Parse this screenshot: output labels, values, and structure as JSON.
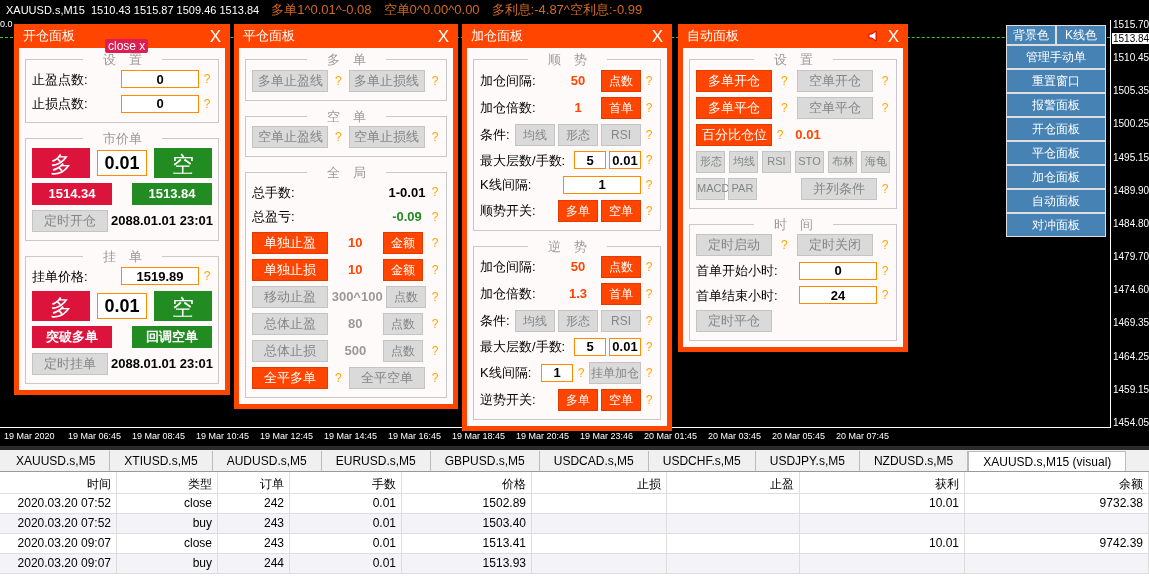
{
  "top_bar": {
    "symbol_info": "XAUUSD.s,M15  1510.43 1515.87 1509.46 1513.84",
    "stats": [
      "多单1^0.01^-0.08",
      "空单0^0.00^0.00",
      "多利息:-4.87^空利息:-0.99"
    ],
    "indicator_value": "0.0"
  },
  "panels": [
    {
      "title": "开仓面板",
      "close": "X",
      "badge": "close x",
      "sections": [
        {
          "title": "设　置",
          "rows": [
            {
              "items": [
                {
                  "kind": "label",
                  "text": "止盈点数:"
                },
                {
                  "kind": "field",
                  "text": "0"
                },
                {
                  "kind": "help",
                  "text": "?"
                }
              ]
            },
            {
              "items": [
                {
                  "kind": "label",
                  "text": "止损点数:"
                },
                {
                  "kind": "field",
                  "text": "0"
                },
                {
                  "kind": "help",
                  "text": "?"
                }
              ]
            }
          ]
        },
        {
          "title": "市价单",
          "rows": [
            {
              "items": [
                {
                  "kind": "buy_big",
                  "text": "多"
                },
                {
                  "kind": "lot_field",
                  "text": "0.01"
                },
                {
                  "kind": "sell_big",
                  "text": "空"
                }
              ]
            },
            {
              "items": [
                {
                  "kind": "buy",
                  "text": "1514.34"
                },
                {
                  "kind": "sell",
                  "text": "1513.84"
                }
              ]
            },
            {
              "items": [
                {
                  "kind": "button",
                  "text": "定时开仓",
                  "active": false
                },
                {
                  "kind": "value",
                  "text": "2088.01.01 23:01",
                  "color": "#000000"
                }
              ]
            }
          ]
        },
        {
          "title": "挂　单",
          "rows": [
            {
              "items": [
                {
                  "kind": "label",
                  "text": "挂单价格:"
                },
                {
                  "kind": "field",
                  "text": "1519.89"
                },
                {
                  "kind": "help",
                  "text": "?"
                }
              ]
            },
            {
              "items": [
                {
                  "kind": "buy_big",
                  "text": "多"
                },
                {
                  "kind": "lot_field",
                  "text": "0.01"
                },
                {
                  "kind": "sell_big",
                  "text": "空"
                }
              ]
            },
            {
              "items": [
                {
                  "kind": "buy",
                  "text": "突破多单"
                },
                {
                  "kind": "sell",
                  "text": "回调空单"
                }
              ]
            },
            {
              "items": [
                {
                  "kind": "button",
                  "text": "定时挂单",
                  "active": false
                },
                {
                  "kind": "value",
                  "text": "2088.01.01 23:01",
                  "color": "#000000"
                }
              ]
            }
          ]
        }
      ]
    },
    {
      "title": "平仓面板",
      "close": "X",
      "sections": [
        {
          "title": "多　单",
          "rows": [
            {
              "items": [
                {
                  "kind": "button",
                  "text": "多单止盈线",
                  "active": false
                },
                {
                  "kind": "help",
                  "text": "?"
                },
                {
                  "kind": "button",
                  "text": "多单止损线",
                  "active": false
                },
                {
                  "kind": "help",
                  "text": "?"
                }
              ]
            }
          ]
        },
        {
          "title": "空　单",
          "rows": [
            {
              "items": [
                {
                  "kind": "button",
                  "text": "空单止盈线",
                  "active": false
                },
                {
                  "kind": "help",
                  "text": "?"
                },
                {
                  "kind": "button",
                  "text": "空单止损线",
                  "active": false
                },
                {
                  "kind": "help",
                  "text": "?"
                }
              ]
            }
          ]
        },
        {
          "title": "全　局",
          "rows": [
            {
              "items": [
                {
                  "kind": "label",
                  "text": "总手数:"
                },
                {
                  "kind": "value",
                  "text": "1-0.01",
                  "color": "#000000"
                },
                {
                  "kind": "help",
                  "text": "?"
                }
              ]
            },
            {
              "items": [
                {
                  "kind": "label",
                  "text": "总盈亏:"
                },
                {
                  "kind": "value",
                  "text": "-0.09",
                  "color": "#228b22"
                },
                {
                  "kind": "help",
                  "text": "?"
                }
              ]
            },
            {
              "items": [
                {
                  "kind": "button",
                  "text": "单独止盈",
                  "active": true
                },
                {
                  "kind": "value",
                  "text": "10",
                  "color": "#ff4500"
                },
                {
                  "kind": "small_button",
                  "text": "金额",
                  "active": true
                },
                {
                  "kind": "help",
                  "text": "?"
                }
              ]
            },
            {
              "items": [
                {
                  "kind": "button",
                  "text": "单独止损",
                  "active": true
                },
                {
                  "kind": "value",
                  "text": "10",
                  "color": "#ff4500"
                },
                {
                  "kind": "small_button",
                  "text": "金额",
                  "active": true
                },
                {
                  "kind": "help",
                  "text": "?"
                }
              ]
            },
            {
              "items": [
                {
                  "kind": "button",
                  "text": "移动止盈",
                  "active": false
                },
                {
                  "kind": "value",
                  "text": "300^100",
                  "color": "#999999"
                },
                {
                  "kind": "small_button",
                  "text": "点数",
                  "active": false
                },
                {
                  "kind": "help",
                  "text": "?"
                }
              ]
            },
            {
              "items": [
                {
                  "kind": "button",
                  "text": "总体止盈",
                  "active": false
                },
                {
                  "kind": "value",
                  "text": "80",
                  "color": "#999999"
                },
                {
                  "kind": "small_button",
                  "text": "点数",
                  "active": false
                },
                {
                  "kind": "help",
                  "text": "?"
                }
              ]
            },
            {
              "items": [
                {
                  "kind": "button",
                  "text": "总体止损",
                  "active": false
                },
                {
                  "kind": "value",
                  "text": "500",
                  "color": "#999999"
                },
                {
                  "kind": "small_button",
                  "text": "点数",
                  "active": false
                },
                {
                  "kind": "help",
                  "text": "?"
                }
              ]
            },
            {
              "items": [
                {
                  "kind": "button",
                  "text": "全平多单",
                  "active": true
                },
                {
                  "kind": "help",
                  "text": "?"
                },
                {
                  "kind": "button",
                  "text": "全平空单",
                  "active": false
                },
                {
                  "kind": "help",
                  "text": "?"
                }
              ]
            }
          ]
        }
      ]
    },
    {
      "title": "加仓面板",
      "close": "X",
      "sections": [
        {
          "title": "顺　势",
          "rows": [
            {
              "items": [
                {
                  "kind": "label",
                  "text": "加仓间隔:"
                },
                {
                  "kind": "value",
                  "text": "50",
                  "color": "#ff4500"
                },
                {
                  "kind": "small_button",
                  "text": "点数",
                  "active": true
                },
                {
                  "kind": "help",
                  "text": "?"
                }
              ]
            },
            {
              "items": [
                {
                  "kind": "label",
                  "text": "加仓倍数:"
                },
                {
                  "kind": "value",
                  "text": "1",
                  "color": "#ff4500"
                },
                {
                  "kind": "small_button",
                  "text": "首单",
                  "active": true
                },
                {
                  "kind": "help",
                  "text": "?"
                }
              ]
            },
            {
              "items": [
                {
                  "kind": "label",
                  "text": "条件:"
                },
                {
                  "kind": "small_button",
                  "text": "均线",
                  "active": false
                },
                {
                  "kind": "small_button",
                  "text": "形态",
                  "active": false
                },
                {
                  "kind": "small_button",
                  "text": "RSI",
                  "active": false
                },
                {
                  "kind": "help",
                  "text": "?"
                }
              ]
            },
            {
              "items": [
                {
                  "kind": "label",
                  "text": "最大层数/手数:"
                },
                {
                  "kind": "short_field",
                  "text": "5"
                },
                {
                  "kind": "short_field",
                  "text": "0.01"
                },
                {
                  "kind": "help",
                  "text": "?"
                }
              ]
            },
            {
              "items": [
                {
                  "kind": "label",
                  "text": "K线间隔:"
                },
                {
                  "kind": "field",
                  "text": "1"
                },
                {
                  "kind": "help",
                  "text": "?"
                }
              ]
            },
            {
              "items": [
                {
                  "kind": "label",
                  "text": "顺势开关:"
                },
                {
                  "kind": "small_button",
                  "text": "多单",
                  "active": true
                },
                {
                  "kind": "small_button",
                  "text": "空单",
                  "active": true
                },
                {
                  "kind": "help",
                  "text": "?"
                }
              ]
            }
          ]
        },
        {
          "title": "逆　势",
          "rows": [
            {
              "items": [
                {
                  "kind": "label",
                  "text": "加仓间隔:"
                },
                {
                  "kind": "value",
                  "text": "50",
                  "color": "#ff4500"
                },
                {
                  "kind": "small_button",
                  "text": "点数",
                  "active": true
                },
                {
                  "kind": "help",
                  "text": "?"
                }
              ]
            },
            {
              "items": [
                {
                  "kind": "label",
                  "text": "加仓倍数:"
                },
                {
                  "kind": "value",
                  "text": "1.3",
                  "color": "#ff4500"
                },
                {
                  "kind": "small_button",
                  "text": "首单",
                  "active": true
                },
                {
                  "kind": "help",
                  "text": "?"
                }
              ]
            },
            {
              "items": [
                {
                  "kind": "label",
                  "text": "条件:"
                },
                {
                  "kind": "small_button",
                  "text": "均线",
                  "active": false
                },
                {
                  "kind": "small_button",
                  "text": "形态",
                  "active": false
                },
                {
                  "kind": "small_button",
                  "text": "RSI",
                  "active": false
                },
                {
                  "kind": "help",
                  "text": "?"
                }
              ]
            },
            {
              "items": [
                {
                  "kind": "label",
                  "text": "最大层数/手数:"
                },
                {
                  "kind": "short_field",
                  "text": "5"
                },
                {
                  "kind": "short_field",
                  "text": "0.01"
                },
                {
                  "kind": "help",
                  "text": "?"
                }
              ]
            },
            {
              "items": [
                {
                  "kind": "label",
                  "text": "K线间隔:"
                },
                {
                  "kind": "short_field",
                  "text": "1"
                },
                {
                  "kind": "help",
                  "text": "?"
                },
                {
                  "kind": "medium_button",
                  "text": "挂单加仓",
                  "active": false
                },
                {
                  "kind": "help",
                  "text": "?"
                }
              ]
            },
            {
              "items": [
                {
                  "kind": "label",
                  "text": "逆势开关:"
                },
                {
                  "kind": "small_button",
                  "text": "多单",
                  "active": true
                },
                {
                  "kind": "small_button",
                  "text": "空单",
                  "active": true
                },
                {
                  "kind": "help",
                  "text": "?"
                }
              ]
            }
          ]
        }
      ]
    },
    {
      "title": "自动面板",
      "close": "X",
      "sound_icon": true,
      "sections": [
        {
          "title": "设　置",
          "rows": [
            {
              "items": [
                {
                  "kind": "button",
                  "text": "多单开仓",
                  "active": true
                },
                {
                  "kind": "help",
                  "text": "?"
                },
                {
                  "kind": "button",
                  "text": "空单开仓",
                  "active": false
                },
                {
                  "kind": "help",
                  "text": "?"
                }
              ]
            },
            {
              "items": [
                {
                  "kind": "button",
                  "text": "多单平仓",
                  "active": true
                },
                {
                  "kind": "help",
                  "text": "?"
                },
                {
                  "kind": "button",
                  "text": "空单平仓",
                  "active": false
                },
                {
                  "kind": "help",
                  "text": "?"
                }
              ]
            },
            {
              "items": [
                {
                  "kind": "button",
                  "text": "百分比仓位",
                  "active": true
                },
                {
                  "kind": "help",
                  "text": "?"
                },
                {
                  "kind": "value",
                  "text": "0.01",
                  "color": "#ff4500"
                },
                {
                  "kind": "spacer"
                }
              ]
            },
            {
              "items": [
                {
                  "kind": "tiny_button",
                  "text": "形态",
                  "active": false
                },
                {
                  "kind": "tiny_button",
                  "text": "均线",
                  "active": false
                },
                {
                  "kind": "tiny_button",
                  "text": "RSI",
                  "active": false
                },
                {
                  "kind": "tiny_button",
                  "text": "STO",
                  "active": false
                },
                {
                  "kind": "tiny_button",
                  "text": "布林",
                  "active": false
                },
                {
                  "kind": "tiny_button",
                  "text": "海龟",
                  "active": false
                }
              ]
            },
            {
              "items": [
                {
                  "kind": "tiny_button",
                  "text": "MACD",
                  "active": false
                },
                {
                  "kind": "tiny_button",
                  "text": "PAR",
                  "active": false
                },
                {
                  "kind": "spacer"
                },
                {
                  "kind": "button",
                  "text": "并列条件",
                  "active": false
                },
                {
                  "kind": "help",
                  "text": "?"
                }
              ]
            }
          ]
        },
        {
          "title": "时　间",
          "rows": [
            {
              "items": [
                {
                  "kind": "button",
                  "text": "定时启动",
                  "active": false
                },
                {
                  "kind": "help",
                  "text": "?"
                },
                {
                  "kind": "button",
                  "text": "定时关闭",
                  "active": false
                },
                {
                  "kind": "help",
                  "text": "?"
                }
              ]
            },
            {
              "items": [
                {
                  "kind": "label",
                  "text": "首单开始小时:"
                },
                {
                  "kind": "field",
                  "text": "0"
                },
                {
                  "kind": "help",
                  "text": "?"
                }
              ]
            },
            {
              "items": [
                {
                  "kind": "label",
                  "text": "首单结束小时:"
                },
                {
                  "kind": "field",
                  "text": "24"
                },
                {
                  "kind": "help",
                  "text": "?"
                }
              ]
            },
            {
              "items": [
                {
                  "kind": "button",
                  "text": "定时平仓",
                  "active": false
                },
                {
                  "kind": "spacer"
                }
              ]
            }
          ]
        }
      ]
    }
  ],
  "menu": {
    "top": [
      "背景色",
      "K线色"
    ],
    "items": [
      "管理手动单",
      "重置窗口",
      "报警面板",
      "开仓面板",
      "平仓面板",
      "加仓面板",
      "自动面板",
      "对冲面板"
    ]
  },
  "price_axis": {
    "labels": [
      "1515.70",
      "1510.45",
      "1505.35",
      "1500.25",
      "1495.15",
      "1489.90",
      "1484.80",
      "1479.70",
      "1474.60",
      "1469.35",
      "1464.25",
      "1459.15",
      "1454.05"
    ],
    "current": "1513.84"
  },
  "time_axis": [
    "19 Mar 2020",
    "19 Mar 06:45",
    "19 Mar 08:45",
    "19 Mar 10:45",
    "19 Mar 12:45",
    "19 Mar 14:45",
    "19 Mar 16:45",
    "19 Mar 18:45",
    "19 Mar 20:45",
    "19 Mar 23:46",
    "20 Mar 01:45",
    "20 Mar 03:45",
    "20 Mar 05:45",
    "20 Mar 07:45"
  ],
  "tabs": [
    {
      "label": "XAUUSD.s,M5",
      "selected": false
    },
    {
      "label": "XTIUSD.s,M5",
      "selected": false
    },
    {
      "label": "AUDUSD.s,M5",
      "selected": false
    },
    {
      "label": "EURUSD.s,M5",
      "selected": false
    },
    {
      "label": "GBPUSD.s,M5",
      "selected": false
    },
    {
      "label": "USDCAD.s,M5",
      "selected": false
    },
    {
      "label": "USDCHF.s,M5",
      "selected": false
    },
    {
      "label": "USDJPY.s,M5",
      "selected": false
    },
    {
      "label": "NZDUSD.s,M5",
      "selected": false
    },
    {
      "label": "XAUUSD.s,M15 (visual)",
      "selected": true
    }
  ],
  "table": {
    "columns": [
      "时间",
      "类型",
      "订单",
      "手数",
      "价格",
      "止损",
      "止盈",
      "获利",
      "余额"
    ],
    "rows": [
      [
        "2020.03.20 07:52",
        "close",
        "242",
        "0.01",
        "1502.89",
        null,
        null,
        "10.01",
        "9732.38"
      ],
      [
        "2020.03.20 07:52",
        "buy",
        "243",
        "0.01",
        "1503.40",
        null,
        null,
        null,
        null
      ],
      [
        "2020.03.20 09:07",
        "close",
        "243",
        "0.01",
        "1513.41",
        null,
        null,
        "10.01",
        "9742.39"
      ],
      [
        "2020.03.20 09:07",
        "buy",
        "244",
        "0.01",
        "1513.93",
        null,
        null,
        null,
        null
      ]
    ]
  }
}
